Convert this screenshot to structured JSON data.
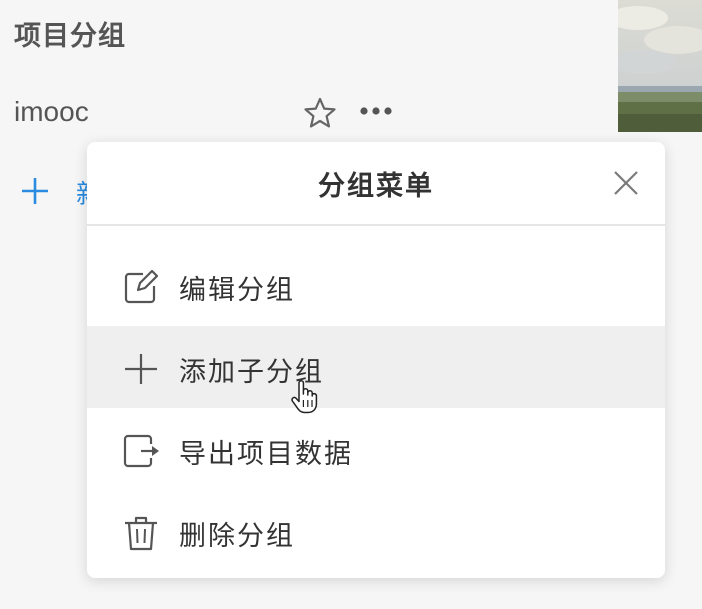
{
  "section": {
    "title": "项目分组"
  },
  "group": {
    "name": "imooc",
    "star_icon": "star-icon",
    "more_icon": "more-dots-icon"
  },
  "add_group": {
    "icon": "plus-icon",
    "label": "新"
  },
  "menu": {
    "title": "分组菜单",
    "close_icon": "close-icon",
    "items": [
      {
        "label": "编辑分组",
        "icon": "edit-icon"
      },
      {
        "label": "添加子分组",
        "icon": "plus-icon",
        "hovered": true
      },
      {
        "label": "导出项目数据",
        "icon": "export-icon"
      },
      {
        "label": "删除分组",
        "icon": "trash-icon"
      }
    ]
  },
  "colors": {
    "accent": "#2a8be0",
    "hover_bg": "#efefef",
    "text": "#333333"
  }
}
